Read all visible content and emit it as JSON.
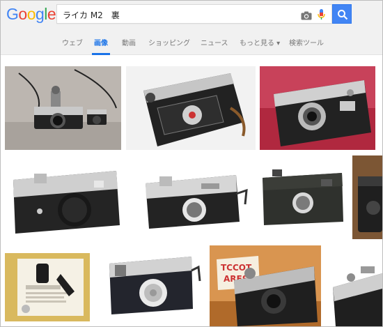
{
  "logo": {
    "text": "Google",
    "colors": [
      "#4285f4",
      "#ea4335",
      "#fbbc05",
      "#4285f4",
      "#34a853",
      "#ea4335"
    ]
  },
  "search": {
    "query": "ライカ M2　裏"
  },
  "icons": {
    "camera": "camera-icon",
    "mic": "mic-icon",
    "search": "search-icon"
  },
  "tabs": [
    {
      "label": "ウェブ"
    },
    {
      "label": "画像"
    },
    {
      "label": "動画"
    },
    {
      "label": "ショッピング"
    },
    {
      "label": "ニュース"
    },
    {
      "label": "もっと見る ▾"
    },
    {
      "label": "検索ツール"
    }
  ],
  "active_tab": "画像",
  "accent_color": "#1a73e8",
  "results": {
    "row3_sign_text": {
      "line1": "TCCOT",
      "line2": "ARES"
    }
  }
}
